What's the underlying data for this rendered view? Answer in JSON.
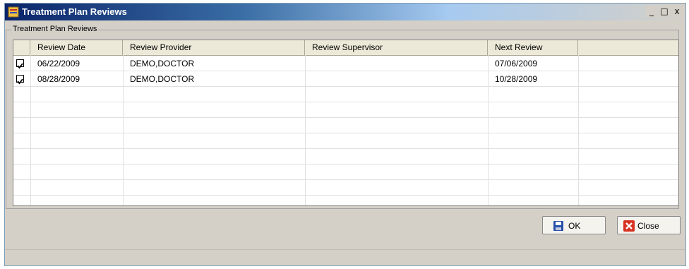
{
  "window": {
    "title": "Treatment Plan Reviews",
    "minimize": "_",
    "maximize": "□",
    "close": "x"
  },
  "group": {
    "label": "Treatment Plan Reviews"
  },
  "grid": {
    "columns": [
      "Review Date",
      "Review Provider",
      "Review Supervisor",
      "Next Review"
    ],
    "rows": [
      {
        "checked": true,
        "review_date": "06/22/2009",
        "provider": "DEMO,DOCTOR",
        "supervisor": "",
        "next_review": "07/06/2009"
      },
      {
        "checked": true,
        "review_date": "08/28/2009",
        "provider": "DEMO,DOCTOR",
        "supervisor": "",
        "next_review": "10/28/2009"
      }
    ]
  },
  "buttons": {
    "ok": "OK",
    "close": "Close"
  },
  "icons": {
    "title": "treatment-plan-icon",
    "ok": "save-disk-icon",
    "close": "close-x-icon"
  }
}
